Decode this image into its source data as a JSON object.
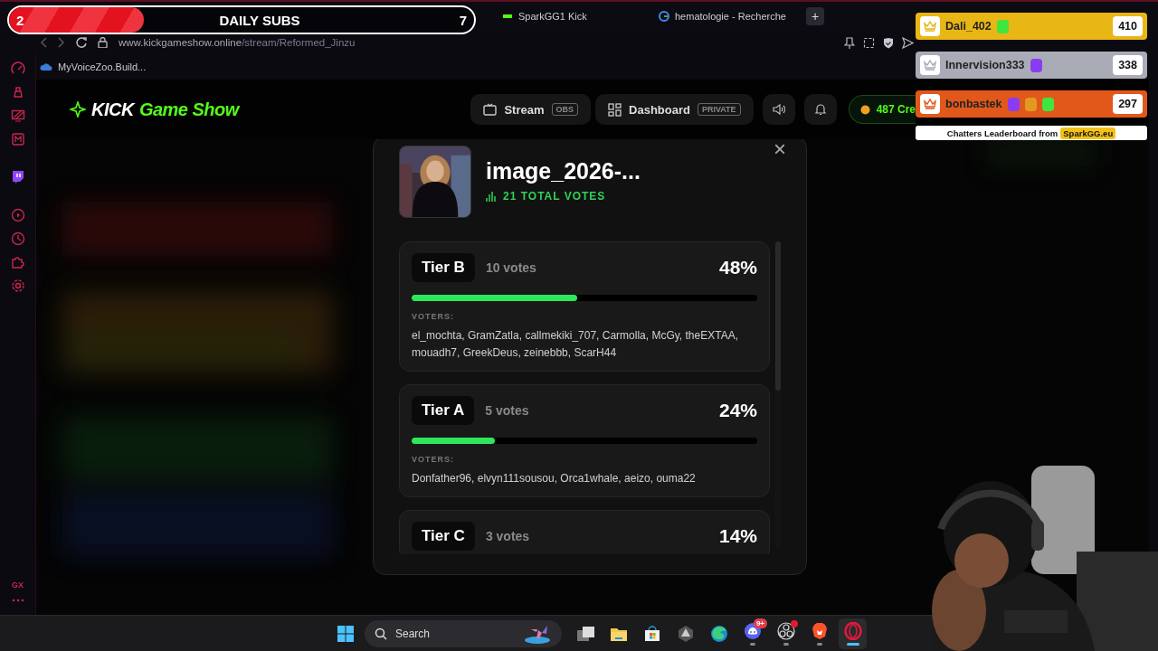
{
  "browser": {
    "tabs": [
      {
        "label": "SparkGG1 Kick",
        "selected": false
      },
      {
        "label": "hematologie - Recherche",
        "selected": false
      }
    ],
    "new_tab": "+",
    "url_host": "www.kickgameshow.online",
    "url_path": "/stream/Reformed_Jinzu",
    "bookmarks": [
      "MyVoiceZoo.Build..."
    ],
    "sidebar_footer": "GX"
  },
  "site_header": {
    "logo_bold": "KICK",
    "logo_rest": "Game Show",
    "nav": [
      {
        "kind": "stream",
        "label": "Stream",
        "tag": "OBS"
      },
      {
        "kind": "dashboard",
        "label": "Dashboard",
        "tag": "PRIVATE"
      }
    ],
    "credits": "487 Cre"
  },
  "poll": {
    "title": "image_2026-...",
    "total_votes": "21 TOTAL VOTES",
    "close": "×",
    "tiers": [
      {
        "name": "Tier B",
        "votes": "10 votes",
        "percent": "48%",
        "level": 0.48,
        "voters_label": "VOTERS:",
        "voters": "el_mochta, GramZatla, callmekiki_707, Carmolla, McGy, theEXTAA, mouadh7, GreekDeus, zeinebbb, ScarH44"
      },
      {
        "name": "Tier A",
        "votes": "5 votes",
        "percent": "24%",
        "level": 0.24,
        "voters_label": "VOTERS:",
        "voters": "Donfather96, elvyn111sousou, Orca1whale, aeizo, ouma22"
      },
      {
        "name": "Tier C",
        "votes": "3 votes",
        "percent": "14%"
      }
    ]
  },
  "daily_subs": {
    "current": "2",
    "label": "DAILY SUBS",
    "goal": "7",
    "level": 0.29
  },
  "leaderboard": {
    "entries": [
      {
        "name": "Dali_402",
        "score": "410",
        "color": "#e8b715",
        "badges": [
          {
            "color": "#3ee63e"
          }
        ]
      },
      {
        "name": "Innervision333",
        "score": "338",
        "color": "#a9acb6",
        "badges": [
          {
            "color": "#8a3cf0"
          }
        ]
      },
      {
        "name": "bonbastek",
        "score": "297",
        "color": "#e2581a",
        "badges": [
          {
            "color": "#8a3cf0"
          },
          {
            "color": "#e09a20"
          },
          {
            "color": "#3ee63e"
          }
        ]
      }
    ],
    "footer_text": "Chatters Leaderboard from",
    "footer_link": "SparkGG.eu"
  },
  "taskbar": {
    "search_placeholder": "Search",
    "apps": [
      {
        "kind": "tasks",
        "running": false,
        "selected": false
      },
      {
        "kind": "folder",
        "running": false,
        "selected": false
      },
      {
        "kind": "store",
        "running": false,
        "selected": false
      },
      {
        "kind": "app",
        "running": false,
        "selected": false
      },
      {
        "kind": "edge",
        "running": false,
        "selected": false
      },
      {
        "kind": "discord",
        "badge": "9+",
        "running": true,
        "selected": false
      },
      {
        "kind": "obs",
        "alert": true,
        "running": true,
        "selected": false
      },
      {
        "kind": "brave",
        "running": true,
        "selected": false
      },
      {
        "kind": "opera",
        "running": true,
        "selected": true
      }
    ]
  }
}
